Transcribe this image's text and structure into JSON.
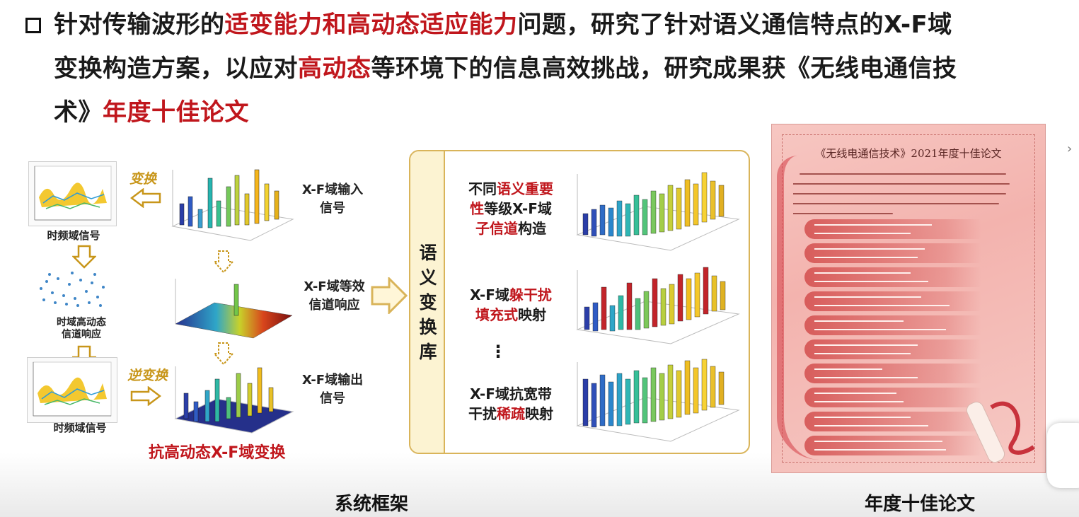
{
  "header": {
    "line1": [
      {
        "text": "针对传输波形的",
        "red": false
      },
      {
        "text": "适变能力和高动态适应能力",
        "red": true
      },
      {
        "text": "问题，研究了针对语义通信特点的X-F域",
        "red": false
      }
    ],
    "line2": [
      {
        "text": "变换构造方案，以应对",
        "red": false
      },
      {
        "text": "高动态",
        "red": true
      },
      {
        "text": "等环境下的信息高效挑战，研究成果获《无线电通信技",
        "red": false
      }
    ],
    "line3": [
      {
        "text": "术》",
        "red": false
      },
      {
        "text": "年度十佳论文",
        "red": true
      }
    ]
  },
  "left": {
    "tf_signal_top": "时频域信号",
    "tf_channel": [
      "时域高动态",
      "信道响应"
    ],
    "tf_signal_bottom": "时频域信号",
    "transform_tag": "变换",
    "inverse_tag": "逆变换",
    "xf_input": [
      "X-F域输入",
      "信号"
    ],
    "xf_channel": [
      "X-F域等效",
      "信道响应"
    ],
    "xf_output": [
      "X-F域输出",
      "信号"
    ],
    "bottom_title": "抗高动态X-F域变换"
  },
  "library": {
    "title": [
      "语",
      "义",
      "变",
      "换",
      "库"
    ],
    "item1": [
      [
        {
          "text": "不同",
          "red": false
        },
        {
          "text": "语义重要",
          "red": true
        }
      ],
      [
        {
          "text": "性",
          "red": true
        },
        {
          "text": "等级X-F域",
          "red": false
        }
      ],
      [
        {
          "text": "子信道",
          "red": true
        },
        {
          "text": "构造",
          "red": false
        }
      ]
    ],
    "item2": [
      [
        {
          "text": "X-F域",
          "red": false
        },
        {
          "text": "躲干扰",
          "red": true
        }
      ],
      [
        {
          "text": "填充式",
          "red": true
        },
        {
          "text": "映射",
          "red": false
        }
      ]
    ],
    "ellipsis": "⋮",
    "item3": [
      [
        {
          "text": "X-F域抗宽带",
          "red": false
        }
      ],
      [
        {
          "text": "干扰",
          "red": false
        },
        {
          "text": "稀疏",
          "red": true
        },
        {
          "text": "映射",
          "red": false
        }
      ]
    ]
  },
  "certificate": {
    "title": "《无线电通信技术》2021年度十佳论文"
  },
  "captions": {
    "left": "系统框架",
    "right": "年度十佳论文"
  }
}
